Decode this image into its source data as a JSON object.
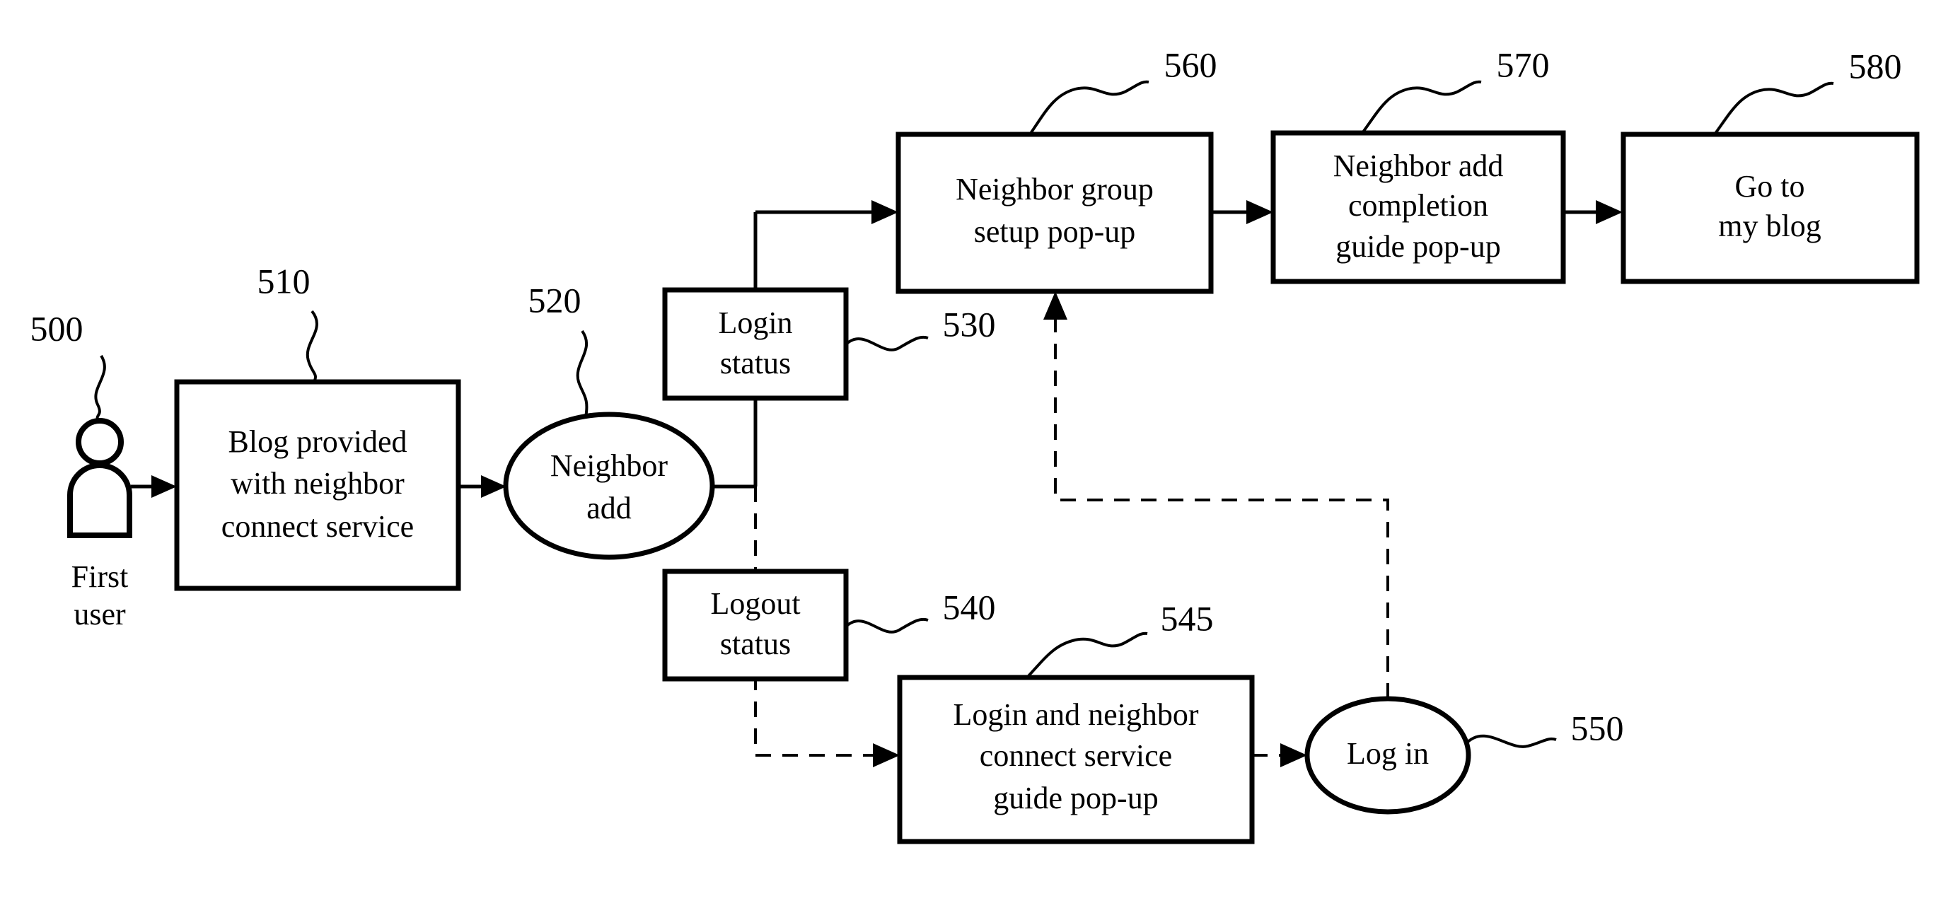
{
  "figure": {
    "type": "patent-flowchart",
    "background_color": "#ffffff",
    "line_color": "#000000"
  },
  "actor": {
    "ref": "500",
    "label_line1": "First",
    "label_line2": "user",
    "icon": "person-icon"
  },
  "nodes": [
    {
      "id": "blog-service",
      "ref": "510",
      "shape": "rect",
      "lines": [
        "Blog provided",
        "with neighbor",
        "connect service"
      ]
    },
    {
      "id": "neighbor-add",
      "ref": "520",
      "shape": "ellipse",
      "lines": [
        "Neighbor",
        "add"
      ]
    },
    {
      "id": "login-status",
      "ref": "530",
      "shape": "rect",
      "lines": [
        "Login",
        "status"
      ]
    },
    {
      "id": "logout-status",
      "ref": "540",
      "shape": "rect",
      "lines": [
        "Logout",
        "status"
      ]
    },
    {
      "id": "login-guide-popup",
      "ref": "545",
      "shape": "rect",
      "lines": [
        "Login and neighbor",
        "connect service",
        "guide pop-up"
      ]
    },
    {
      "id": "log-in",
      "ref": "550",
      "shape": "ellipse",
      "lines": [
        "Log in"
      ]
    },
    {
      "id": "neighbor-group-setup-popup",
      "ref": "560",
      "shape": "rect",
      "lines": [
        "Neighbor group",
        "setup pop-up"
      ]
    },
    {
      "id": "neighbor-add-completion-popup",
      "ref": "570",
      "shape": "rect",
      "lines": [
        "Neighbor add",
        "completion",
        "guide pop-up"
      ]
    },
    {
      "id": "go-to-my-blog",
      "ref": "580",
      "shape": "rect",
      "lines": [
        "Go to",
        "my blog"
      ]
    }
  ],
  "connections": [
    {
      "from": "first-user",
      "to": "blog-service",
      "style": "solid"
    },
    {
      "from": "blog-service",
      "to": "neighbor-add",
      "style": "solid"
    },
    {
      "from": "neighbor-add",
      "to": "login-status",
      "style": "solid"
    },
    {
      "from": "login-status",
      "to": "neighbor-group-setup-popup",
      "style": "solid"
    },
    {
      "from": "neighbor-add",
      "to": "logout-status",
      "style": "dashed"
    },
    {
      "from": "logout-status",
      "to": "login-guide-popup",
      "style": "dashed"
    },
    {
      "from": "login-guide-popup",
      "to": "log-in",
      "style": "dashed"
    },
    {
      "from": "log-in",
      "to": "neighbor-group-setup-popup",
      "style": "dashed"
    },
    {
      "from": "neighbor-group-setup-popup",
      "to": "neighbor-add-completion-popup",
      "style": "solid"
    },
    {
      "from": "neighbor-add-completion-popup",
      "to": "go-to-my-blog",
      "style": "solid"
    }
  ]
}
